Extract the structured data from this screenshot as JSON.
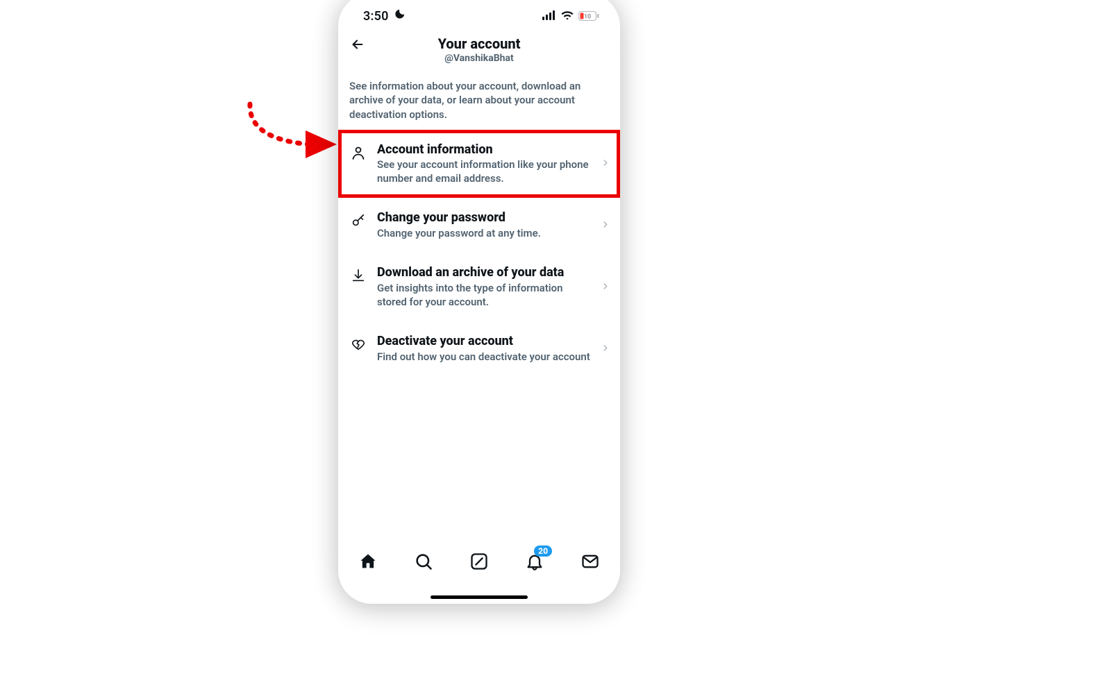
{
  "statusbar": {
    "time": "3:50",
    "battery_pct": "10"
  },
  "header": {
    "title": "Your account",
    "handle": "@VanshikaBhat"
  },
  "description": "See information about your account, download an archive of your data, or learn about your account deactivation options.",
  "rows": [
    {
      "title": "Account information",
      "subtitle": "See your account information like your phone number and email address."
    },
    {
      "title": "Change your password",
      "subtitle": "Change your password at any time."
    },
    {
      "title": "Download an archive of your data",
      "subtitle": "Get insights into the type of information stored for your account."
    },
    {
      "title": "Deactivate your account",
      "subtitle": "Find out how you can deactivate your account"
    }
  ],
  "tabbar": {
    "notifications_badge": "20"
  },
  "colors": {
    "accent": "#1d9bf0",
    "muted": "#536471",
    "annotation": "#eb0000"
  }
}
